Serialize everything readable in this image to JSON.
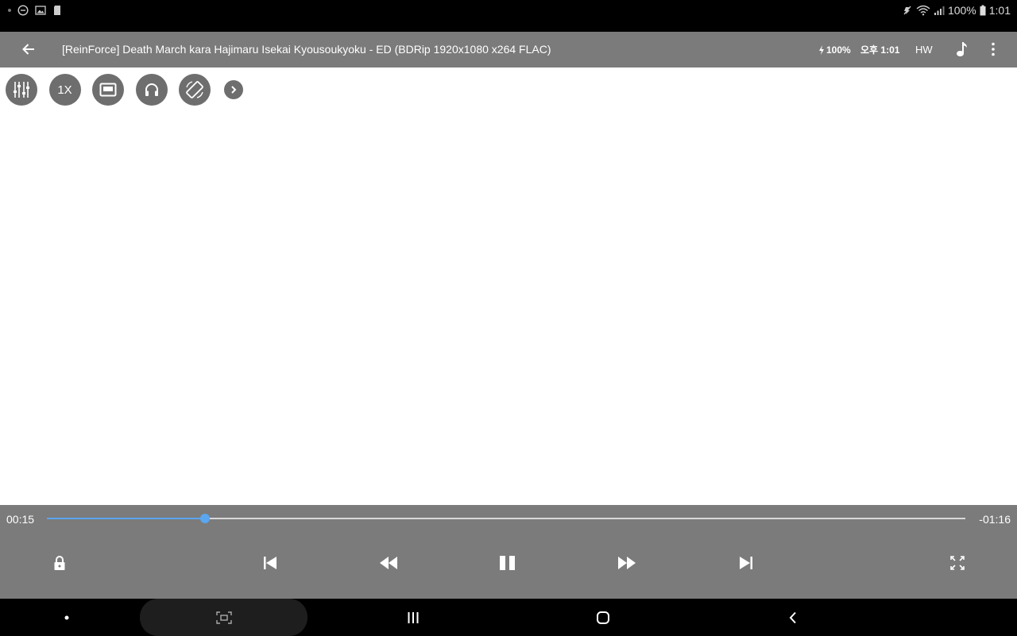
{
  "status_bar": {
    "battery_text": "100%",
    "time": "1:01"
  },
  "title_bar": {
    "title": "[ReinForce] Death March kara Hajimaru Isekai Kyousoukyoku - ED (BDRip 1920x1080 x264 FLAC)",
    "battery_text": "100%",
    "clock_text": "오후 1:01",
    "decoder_label": "HW"
  },
  "quick_tools": {
    "speed_label": "1X"
  },
  "playback": {
    "current_time": "00:15",
    "remaining_time": "-01:16",
    "progress_fraction": 0.172
  },
  "colors": {
    "accent": "#5aa6f0",
    "bar_gray": "#7b7b7b",
    "button_gray": "#6e6e6e"
  }
}
